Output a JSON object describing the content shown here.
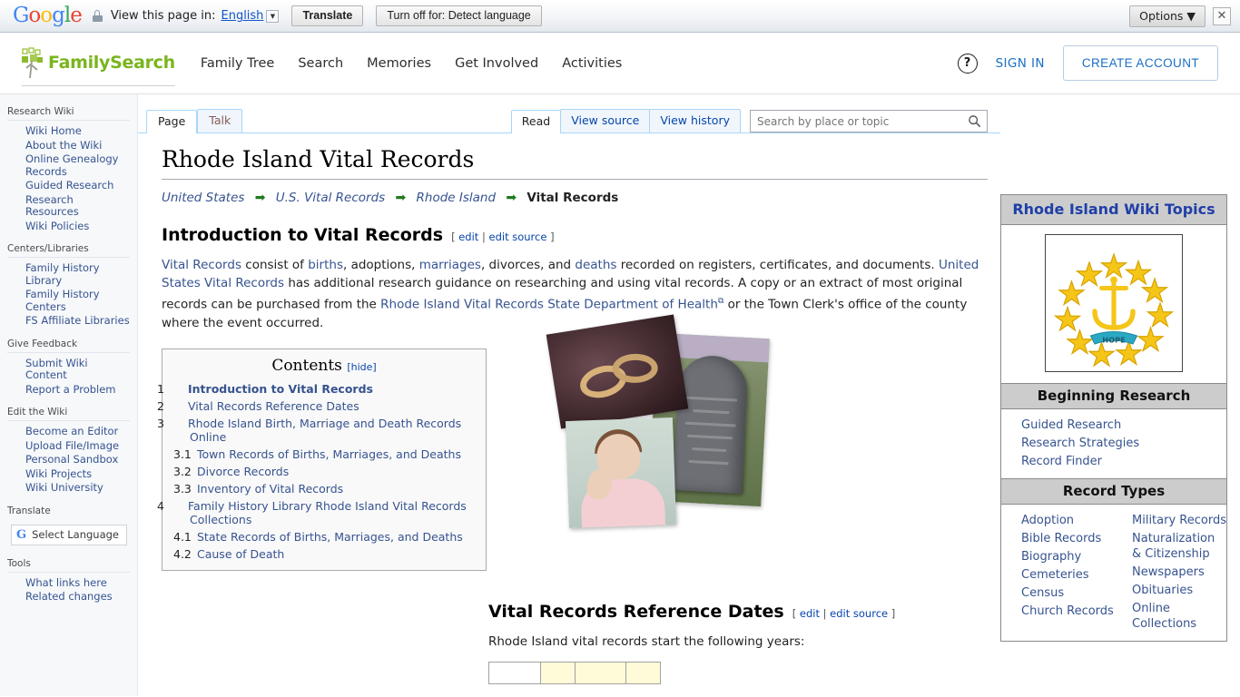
{
  "translate_bar": {
    "brand": "Google",
    "lock_icon": "lock-icon",
    "label": "View this page in:",
    "language": "English",
    "translate_button": "Translate",
    "turn_off_button": "Turn off for: Detect language",
    "options_button": "Options",
    "close_icon": "close-icon"
  },
  "header": {
    "logo_text": "FamilySearch",
    "nav": [
      {
        "label": "Family Tree"
      },
      {
        "label": "Search"
      },
      {
        "label": "Memories"
      },
      {
        "label": "Get Involved"
      },
      {
        "label": "Activities"
      }
    ],
    "help_icon": "question-mark-icon",
    "sign_in": "SIGN IN",
    "create_account": "CREATE ACCOUNT"
  },
  "sidebar": {
    "groups": [
      {
        "title": "Research Wiki",
        "items": [
          {
            "label": "Wiki Home"
          },
          {
            "label": "About the Wiki"
          },
          {
            "label": "Online Genealogy Records"
          },
          {
            "label": "Guided Research"
          },
          {
            "label": "Research Resources"
          },
          {
            "label": "Wiki Policies"
          }
        ]
      },
      {
        "title": "Centers/Libraries",
        "items": [
          {
            "label": "Family History Library"
          },
          {
            "label": "Family History Centers"
          },
          {
            "label": "FS Affiliate Libraries"
          }
        ]
      },
      {
        "title": "Give Feedback",
        "items": [
          {
            "label": "Submit Wiki Content"
          },
          {
            "label": "Report a Problem"
          }
        ]
      },
      {
        "title": "Edit the Wiki",
        "items": [
          {
            "label": "Become an Editor"
          },
          {
            "label": "Upload File/Image"
          },
          {
            "label": "Personal Sandbox"
          },
          {
            "label": "Wiki Projects"
          },
          {
            "label": "Wiki University"
          }
        ]
      }
    ],
    "translate_title": "Translate",
    "select_language": "Select Language",
    "tools_title": "Tools",
    "tools_items": [
      {
        "label": "What links here"
      },
      {
        "label": "Related changes"
      }
    ]
  },
  "tabs": {
    "namespace": [
      {
        "label": "Page",
        "active": true
      },
      {
        "label": "Talk",
        "active": false
      }
    ],
    "actions": [
      {
        "label": "Read",
        "active": true
      },
      {
        "label": "View source",
        "active": false
      },
      {
        "label": "View history",
        "active": false
      }
    ]
  },
  "search": {
    "placeholder": "Search by place or topic",
    "value": "",
    "icon": "search-icon"
  },
  "article": {
    "title": "Rhode Island Vital Records",
    "breadcrumb": [
      {
        "label": "United States",
        "link": true
      },
      {
        "label": "U.S. Vital Records",
        "link": true
      },
      {
        "label": "Rhode Island",
        "link": true
      },
      {
        "label": "Vital Records",
        "link": false
      }
    ],
    "breadcrumb_arrow": "right-arrow-icon",
    "section1": {
      "heading": "Introduction to Vital Records",
      "edit_open": "[",
      "edit": "edit",
      "edit_sep": "|",
      "edit_source": "edit source",
      "edit_close": "]",
      "paragraph_parts": [
        {
          "text": "Vital Records",
          "link": true
        },
        {
          "text": " consist of ",
          "link": false
        },
        {
          "text": "births",
          "link": true
        },
        {
          "text": ", adoptions, ",
          "link": false
        },
        {
          "text": "marriages",
          "link": true
        },
        {
          "text": ", divorces, and ",
          "link": false
        },
        {
          "text": "deaths",
          "link": true
        },
        {
          "text": " recorded on registers, certificates, and documents. ",
          "link": false
        },
        {
          "text": "United States Vital Records",
          "link": true
        },
        {
          "text": " has additional research guidance on researching and using vital records. A copy or an extract of most original records can be purchased from the ",
          "link": false
        },
        {
          "text": "Rhode Island Vital Records State Department of Health",
          "link": true,
          "external": true
        },
        {
          "text": " or the Town Clerk's office of the county where the event occurred.",
          "link": false
        }
      ]
    },
    "section2": {
      "heading": "Vital Records Reference Dates",
      "intro": "Rhode Island vital records start the following years:"
    }
  },
  "toc": {
    "title": "Contents",
    "hide_label": "[hide]",
    "entries": [
      {
        "num": "1",
        "label": "Introduction to Vital Records",
        "level": 1,
        "current": true
      },
      {
        "num": "2",
        "label": "Vital Records Reference Dates",
        "level": 1,
        "current": false
      },
      {
        "num": "3",
        "label": "Rhode Island Birth, Marriage and Death Records Online",
        "level": 1,
        "current": false
      },
      {
        "num": "3.1",
        "label": "Town Records of Births, Marriages, and Deaths",
        "level": 2,
        "current": false
      },
      {
        "num": "3.2",
        "label": "Divorce Records",
        "level": 2,
        "current": false
      },
      {
        "num": "3.3",
        "label": "Inventory of Vital Records",
        "level": 2,
        "current": false
      },
      {
        "num": "4",
        "label": "Family History Library Rhode Island Vital Records Collections",
        "level": 1,
        "current": false
      },
      {
        "num": "4.1",
        "label": "State Records of Births, Marriages, and Deaths",
        "level": 2,
        "current": false
      },
      {
        "num": "4.2",
        "label": "Cause of Death",
        "level": 2,
        "current": false
      }
    ]
  },
  "collage": {
    "images": [
      {
        "name": "wedding-rings-photo"
      },
      {
        "name": "gravestone-photo"
      },
      {
        "name": "baby-photo"
      }
    ]
  },
  "topics": {
    "heading": "Rhode Island Wiki Topics",
    "flag_alt": "rhode-island-flag",
    "sections": [
      {
        "title": "Beginning Research",
        "columns": [
          [
            {
              "label": "Guided Research"
            },
            {
              "label": "Research Strategies"
            },
            {
              "label": "Record Finder"
            }
          ]
        ]
      },
      {
        "title": "Record Types",
        "columns": [
          [
            {
              "label": "Adoption"
            },
            {
              "label": "Bible Records"
            },
            {
              "label": "Biography"
            },
            {
              "label": "Cemeteries"
            },
            {
              "label": "Census"
            },
            {
              "label": "Church Records"
            }
          ],
          [
            {
              "label": "Military Records"
            },
            {
              "label": "Naturalization & Citizenship"
            },
            {
              "label": "Newspapers"
            },
            {
              "label": "Obituaries"
            },
            {
              "label": "Online Collections"
            }
          ]
        ]
      }
    ]
  },
  "colors": {
    "brand_green": "#7ab51d",
    "link_blue": "#36538f",
    "tab_border": "#a7d7f9",
    "topics_header_bg": "#cccccc",
    "table_header_bg": "#fffbd8"
  }
}
